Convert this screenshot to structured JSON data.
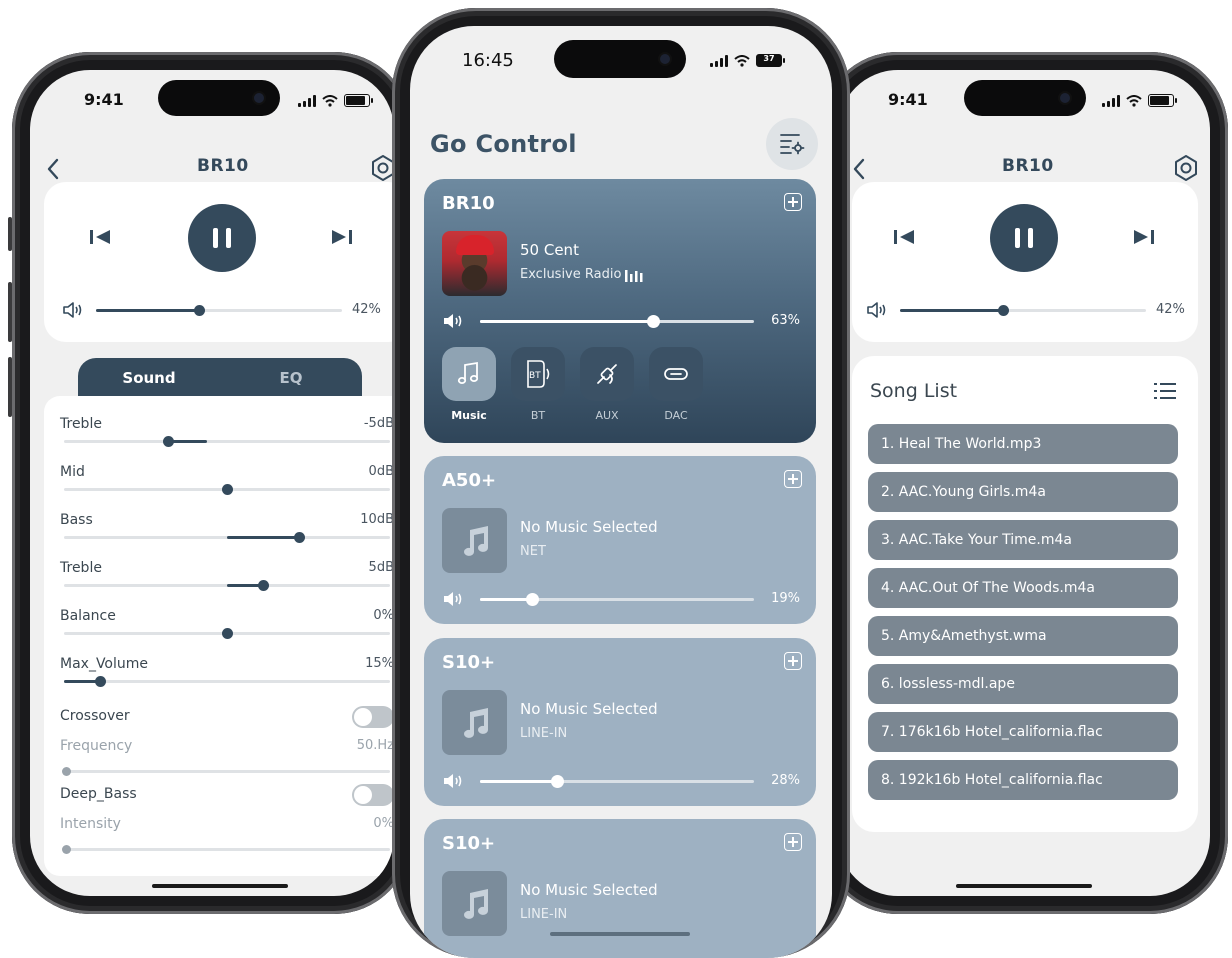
{
  "left_phone": {
    "time": "9:41",
    "title": "BR10",
    "volume_pct": "42%",
    "volume_value": 42,
    "tabs": {
      "sound": "Sound",
      "eq": "EQ"
    },
    "eq": [
      {
        "label": "Treble",
        "value": "-5dB"
      },
      {
        "label": "Mid",
        "value": "0dB"
      },
      {
        "label": "Bass",
        "value": "10dB"
      },
      {
        "label": "Treble",
        "value": "5dB"
      },
      {
        "label": "Balance",
        "value": "0%"
      },
      {
        "label": "Max_Volume",
        "value": "15%"
      }
    ],
    "crossover": {
      "label": "Crossover",
      "freq_label": "Frequency",
      "freq_value": "50.Hz"
    },
    "deep_bass": {
      "label": "Deep_Bass",
      "intensity_label": "Intensity",
      "intensity_value": "0%"
    }
  },
  "center_phone": {
    "time": "16:45",
    "battery": "37",
    "title": "Go Control",
    "devices": [
      {
        "name": "BR10",
        "line1": "50 Cent",
        "line2": "Exclusive Radio",
        "volume": "63%",
        "volume_value": 63
      },
      {
        "name": "A50+",
        "line1": "No Music Selected",
        "line2": "NET",
        "volume": "19%",
        "volume_value": 19
      },
      {
        "name": "S10+",
        "line1": "No Music Selected",
        "line2": "LINE-IN",
        "volume": "28%",
        "volume_value": 28
      },
      {
        "name": "S10+",
        "line1": "No Music Selected",
        "line2": "LINE-IN"
      }
    ],
    "sources": [
      "Music",
      "BT",
      "AUX",
      "DAC"
    ],
    "bt_icon_text": "BT"
  },
  "right_phone": {
    "time": "9:41",
    "title": "BR10",
    "volume_pct": "42%",
    "volume_value": 42,
    "song_list_title": "Song List",
    "songs": [
      "1. Heal The World.mp3",
      "2. AAC.Young Girls.m4a",
      "3. AAC.Take Your Time.m4a",
      "4. AAC.Out Of The Woods.m4a",
      "5. Amy&Amethyst.wma",
      "6. lossless-mdl.ape",
      "7. 176k16b Hotel_california.flac",
      "8. 192k16b Hotel_california.flac"
    ]
  },
  "colors": {
    "accent": "#344a5c",
    "song_bg": "#7b8792",
    "card_sub": "#9eb1c2"
  }
}
